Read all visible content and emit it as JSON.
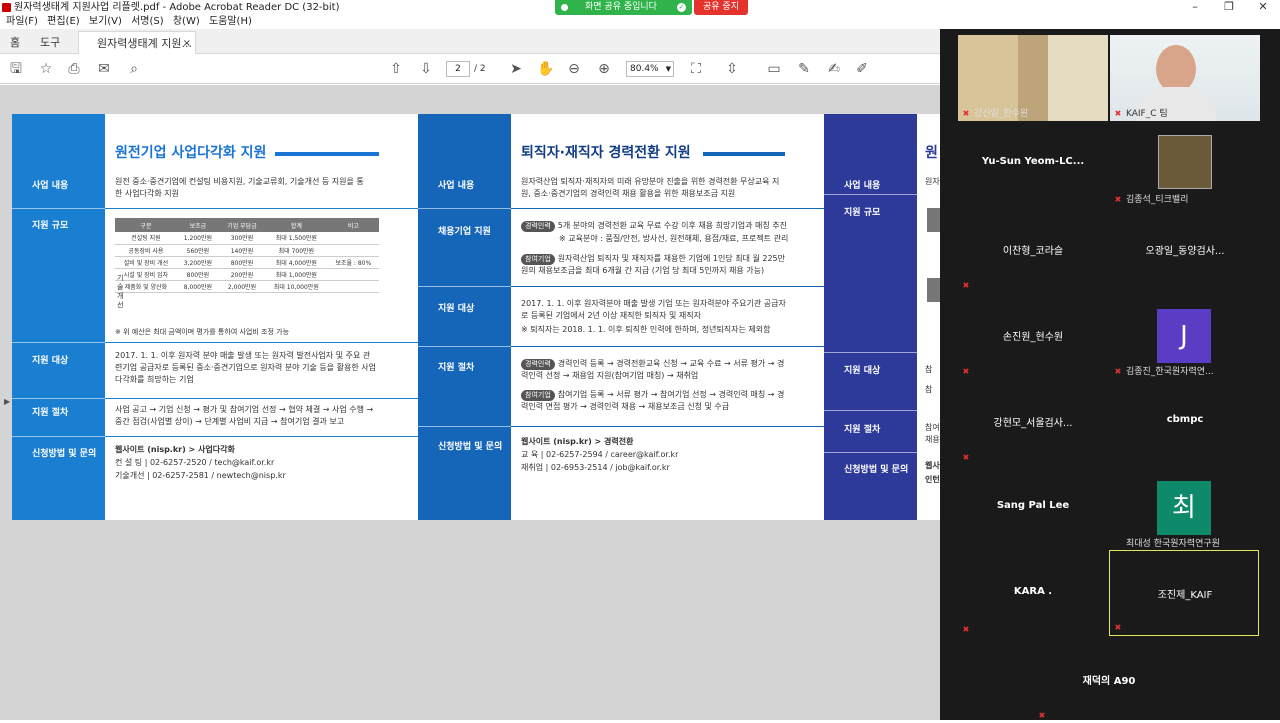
{
  "window": {
    "title": "원자력생태계 지원사업 리플렛.pdf - Adobe Acrobat Reader DC (32-bit)",
    "minimize": "–",
    "maximize": "❐",
    "close": "✕"
  },
  "share_banner": {
    "label": "화면 공유 중입니다",
    "stop_label": "공유 중지",
    "color": "#2fb34a",
    "stop_color": "#e4332d"
  },
  "menu": [
    "파일(F)",
    "편집(E)",
    "보기(V)",
    "서명(S)",
    "창(W)",
    "도움말(H)"
  ],
  "tabs": {
    "home": "홈",
    "tools": "도구",
    "doc": "원자력생태계 지원...",
    "doc_close": "×"
  },
  "toolbar": {
    "page_current": "2",
    "page_total": "/ 2",
    "zoom": "80.4%"
  },
  "doc": {
    "panel1": {
      "title": "원전기업 사업다각화 지원",
      "labels": [
        "사업 내용",
        "지원 규모",
        "지원 대상",
        "지원 절차",
        "신청방법 및 문의"
      ],
      "content": "원전 중소·중견기업에 컨설팅 비용지원, 기술교류회, 기술개선 등 지원을 통한 사업다각화 지원",
      "table_headers": [
        "구분",
        "보조금",
        "기업 부담금",
        "합계",
        "비고"
      ],
      "table_rows": [
        [
          "컨설팅 지원",
          "1,200만원",
          "300만원",
          "최대 1,500만원",
          ""
        ],
        [
          "공동장비 사용",
          "560만원",
          "140만원",
          "최대 700만원",
          ""
        ],
        [
          "설비 및 장비 개선",
          "3,200만원",
          "800만원",
          "최대 4,000만원",
          "보조율 : 80%"
        ],
        [
          "시설 및 장비 임차",
          "800만원",
          "200만원",
          "최대 1,000만원",
          ""
        ],
        [
          "제품화 및 양산화",
          "8,000만원",
          "2,000만원",
          "최대 10,000만원",
          ""
        ]
      ],
      "tech_label": "기술개선",
      "table_note": "※ 위 예산은 최대 금액이며 평가를 통하여 사업비 조정 가능",
      "target": "2017. 1. 1. 이후 원자력 분야 매출 발생 또는 원자력 발전사업자 및 주요 관련기업 공급자로 등록된 중소·중견기업으로 원자력 분야 기술 등을 활용한 사업다각화를 희망하는 기업",
      "procedure": "사업 공고 → 기업 신청 → 평가 및 참여기업 선정 → 협약 체결 → 사업 수행 → 중간 점검(사업별 상이) → 단계별 사업비 지급 → 참여기업 결과 보고",
      "contact1": "웹사이트 (nisp.kr) > 사업다각화",
      "contact2": "컨 설 팅 | 02-6257-2520 / tech@kaif.or.kr",
      "contact3": "기술개선 | 02-6257-2581 / newtech@nisp.kr"
    },
    "panel2": {
      "title": "퇴직자·재직자 경력전환 지원",
      "labels": [
        "사업 내용",
        "채용기업 지원",
        "지원 대상",
        "지원 절차",
        "신청방법 및 문의"
      ],
      "content": "원자력산업 퇴직자·재직자의 미래 유망분야 진출을 위한 경력전환 무상교육 지원, 중소·중견기업의 경력인력 채용 활용을 위한 채용보조금 지원",
      "pill1": "경력인력",
      "hire1": "5개 분야의 경력전환 교육 무료 수강 이후 채용 희망기업과 매칭 추진",
      "hire1b": "※ 교육분야 : 품질/안전, 방사선, 원전해체, 용접/재료, 프로젝트 관리",
      "pill2": "참여기업",
      "hire2": "원자력산업 퇴직자 및 재직자를 채용한 기업에 1인당 최대 월 225만원의 채용보조금을 최대 6개월 간 지급 (기업 당 최대 5인까지 채용 가능)",
      "target": "2017. 1. 1. 이후 원자력분야 매출 발생 기업 또는 원자력분야 주요기관 공급자로 등록된 기업에서 2년 이상 재직한 퇴직자 및 재직자",
      "target_note": "※ 퇴직자는 2018. 1. 1. 이후 퇴직한 인력에 한하며, 정년퇴직자는 제외함",
      "proc1": "경력인력 등록 → 경력전환교육 신청 → 교육 수료 → 서류 평가 → 경력인력 선정 → 채용업 지원(참여기업 매칭) → 채취업",
      "proc2": "참여기업 등록 → 서류 평가 → 참여기업 선정 → 경력인력 매칭 → 경력인력 면접 평가 → 경력인력 채용 → 채용보조금 신청 및 수급",
      "contact1": "웹사이트 (nisp.kr) > 경력전환",
      "contact2": "교 육 | 02-6257-2594 / career@kaif.or.kr",
      "contact3": "재취업 | 02-6953-2514 / job@kaif.or.kr"
    },
    "panel3": {
      "title_partial": "원",
      "labels": [
        "사업 내용",
        "지원 규모",
        "지원 대상",
        "지원 절차",
        "신청방법 및 문의"
      ],
      "frag1": "원자",
      "frag2": "참",
      "frag3": "참",
      "frag4": "참여",
      "frag5": "채용",
      "frag6": "웹사",
      "frag7": "인턴"
    }
  },
  "participants": [
    {
      "name": "강신일_한수원",
      "video": true
    },
    {
      "name": "KAIF_C 팀",
      "video": true
    },
    {
      "name": "Yu-Sun  Yeom-LC...",
      "video": false
    },
    {
      "name": "김종석_티크밸리",
      "video": true
    },
    {
      "name": "이찬형_코라슬",
      "video": false
    },
    {
      "name": "오광일_동양검사...",
      "video": false
    },
    {
      "name": "손진원_현수원",
      "video": false
    },
    {
      "name": "김종진_한국원자력연...",
      "avatar": "J",
      "avatar_color": "#5b3cc4"
    },
    {
      "name": "강현모_서울검사...",
      "video": false
    },
    {
      "name": "cbmpc",
      "video": false
    },
    {
      "name": "Sang Pal Lee",
      "video": false
    },
    {
      "name": "최대성 한국원자력연구원",
      "avatar": "최",
      "avatar_color": "#0e8a6a"
    },
    {
      "name": "KARA .",
      "video": false
    },
    {
      "name": "조진제_KAIF",
      "video": false,
      "active": true
    },
    {
      "name": "재덕의 A90",
      "video": false
    }
  ]
}
